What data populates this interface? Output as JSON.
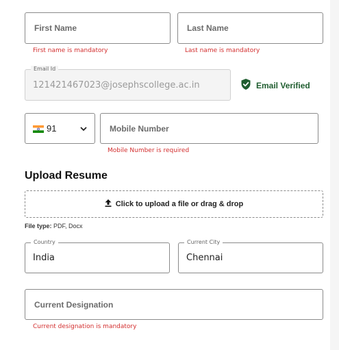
{
  "form": {
    "first_name": {
      "placeholder": "First Name",
      "error": "First name is mandatory"
    },
    "last_name": {
      "placeholder": "Last Name",
      "error": "Last name is mandatory"
    },
    "email": {
      "label": "Email Id",
      "value": "121421467023@josephscollege.ac.in",
      "status": "Email Verified",
      "status_color": "#1f5d2f"
    },
    "phone": {
      "country_code": "91",
      "flag_icon": "india-flag-icon",
      "placeholder": "Mobile Number",
      "error": "Mobile Number is required"
    },
    "resume": {
      "title": "Upload Resume",
      "dropzone_text": "Click to upload a file or drag & drop",
      "file_type_label": "File type:",
      "file_types": "PDF, Docx"
    },
    "country": {
      "label": "Country",
      "value": "India"
    },
    "city": {
      "label": "Current City",
      "value": "Chennai"
    },
    "designation": {
      "placeholder": "Current Designation",
      "error": "Current designation is mandatory"
    }
  },
  "colors": {
    "error": "#d32f2f",
    "verified": "#1f5d2f",
    "border": "#8a8a8a"
  }
}
